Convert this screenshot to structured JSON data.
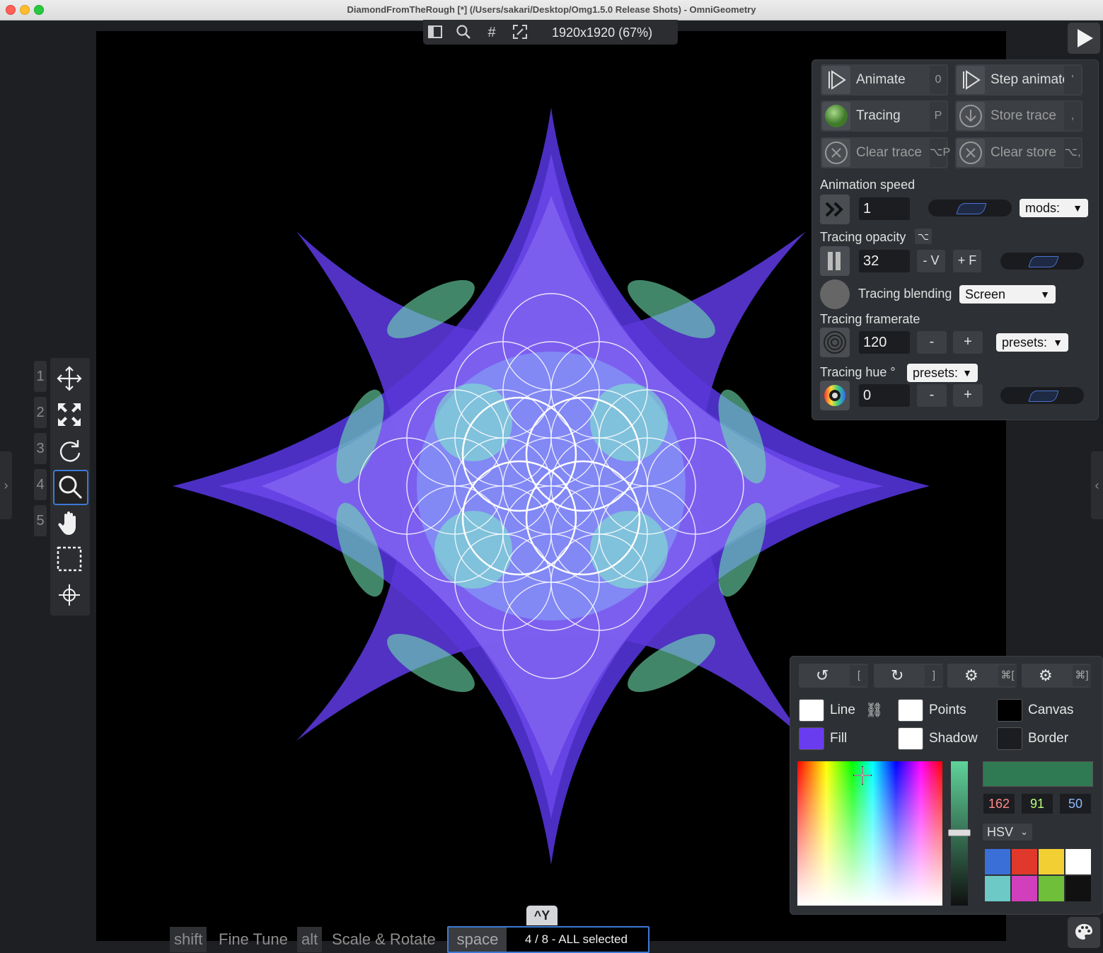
{
  "window": {
    "title": "DiamondFromTheRough [*] (/Users/sakari/Desktop/Omg1.5.0 Release Shots) - OmniGeometry"
  },
  "topbar": {
    "resolution": "1920x1920 (67%)",
    "icons": [
      "sidebar-icon",
      "zoom-icon",
      "grid-icon",
      "fullscreen-icon"
    ]
  },
  "tools": {
    "numbers": [
      "1",
      "2",
      "3",
      "4",
      "5"
    ],
    "items": [
      "move-icon",
      "scale-icon",
      "rotate-icon",
      "zoom-icon",
      "hand-icon",
      "select-rect-icon",
      "crosshair-icon"
    ],
    "active": 3
  },
  "tracing": {
    "buttons": [
      {
        "label": "Animate",
        "key": "0"
      },
      {
        "label": "Step animate",
        "key": "'"
      },
      {
        "label": "Tracing",
        "key": "P"
      },
      {
        "label": "Store trace",
        "key": ","
      },
      {
        "label": "Clear trace",
        "key": "⌥P"
      },
      {
        "label": "Clear store",
        "key": "⌥,"
      }
    ],
    "animation_speed": {
      "label": "Animation speed",
      "value": "1",
      "mods": "mods:"
    },
    "opacity": {
      "label": "Tracing opacity",
      "alt": "⌥",
      "value": "32",
      "minus": "- V",
      "plus": "+ F"
    },
    "blending": {
      "label": "Tracing blending",
      "value": "Screen"
    },
    "framerate": {
      "label": "Tracing framerate",
      "value": "120",
      "minus": "-",
      "plus": "+",
      "presets": "presets:"
    },
    "hue": {
      "label": "Tracing hue °",
      "presets": "presets:",
      "value": "0",
      "minus": "-",
      "plus": "+"
    }
  },
  "colors": {
    "tool_keys": [
      "[",
      "]",
      "⌘[",
      "⌘]"
    ],
    "labels": {
      "line": "Line",
      "points": "Points",
      "canvas": "Canvas",
      "fill": "Fill",
      "shadow": "Shadow",
      "border": "Border"
    },
    "swatches": {
      "line": "#ffffff",
      "points": "#ffffff",
      "canvas": "#000000",
      "fill": "#6a3cf0",
      "shadow": "#ffffff",
      "border": "#1c1d20"
    },
    "hsv": {
      "h": "162",
      "s": "91",
      "v": "50"
    },
    "mode": "HSV",
    "palette": [
      "#3a6fd8",
      "#e0392b",
      "#f2d034",
      "#ffffff",
      "#6cc9c5",
      "#d23fbd",
      "#6fbf3a",
      "#111111"
    ]
  },
  "status": {
    "shift": "shift",
    "fine_tune": "Fine Tune",
    "alt": "alt",
    "scale_rotate": "Scale & Rotate",
    "space": "space",
    "selection": "4 / 8 - ALL selected",
    "ctrl_y": "^Y"
  }
}
